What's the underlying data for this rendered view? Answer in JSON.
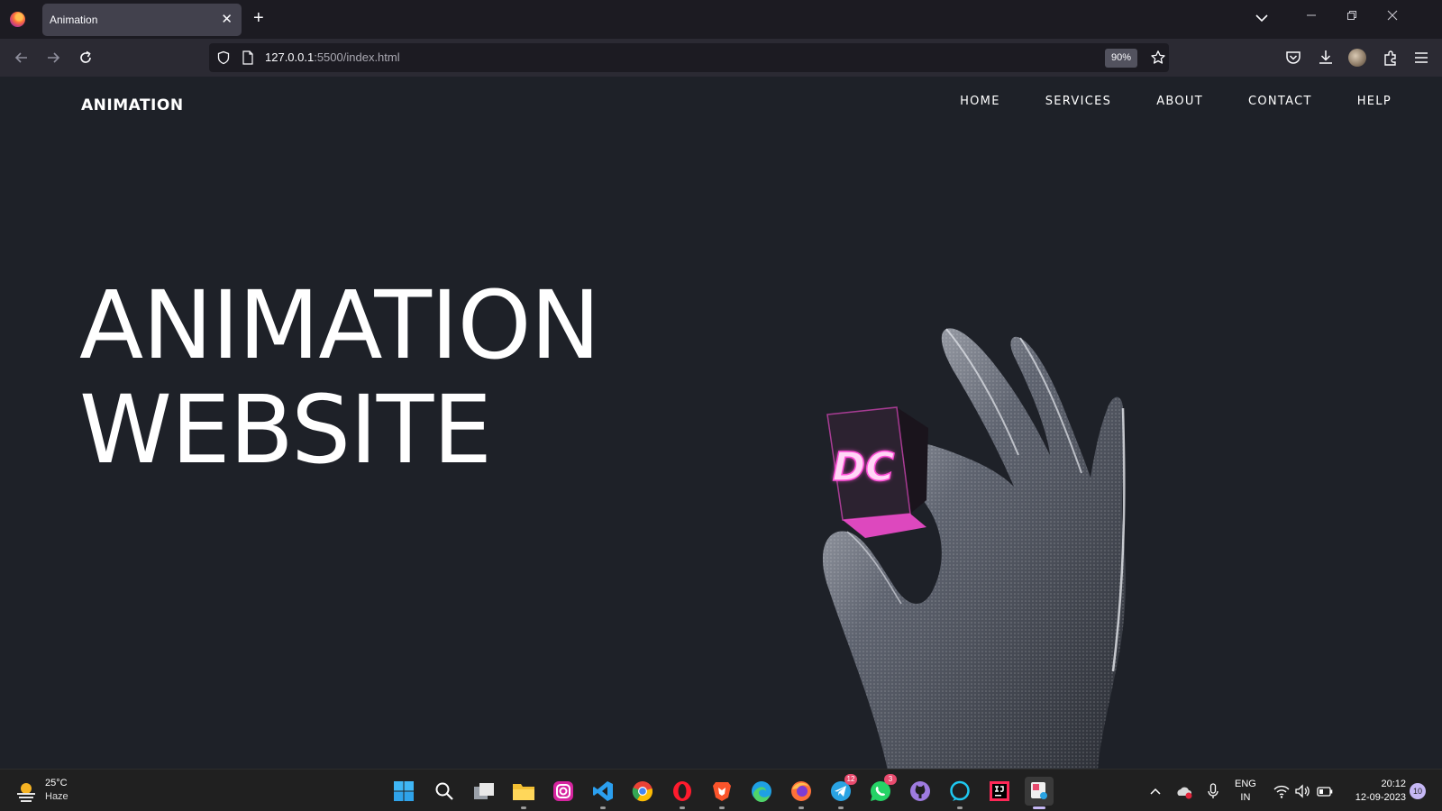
{
  "browser": {
    "tab_title": "Animation",
    "url_host": "127.0.0.1",
    "url_path": ":5500/index.html",
    "zoom": "90%"
  },
  "page": {
    "logo": "ANIMATION",
    "nav": [
      "HOME",
      "SERVICES",
      "ABOUT",
      "CONTACT",
      "HELP"
    ],
    "hero_line1": "ANIMATION",
    "hero_line2": "WEBSITE",
    "cube_text": "DC"
  },
  "taskbar": {
    "weather_temp": "25°C",
    "weather_cond": "Haze",
    "telegram_badge": "12",
    "whatsapp_badge": "3",
    "lang_1": "ENG",
    "lang_2": "IN",
    "time": "20:12",
    "date": "12-09-2023",
    "notifications": "10"
  },
  "colors": {
    "page_bg": "#1e2128",
    "accent_pink": "#ff4fd8",
    "tab_bar": "#1c1b22",
    "nav_bar": "#2b2a33"
  }
}
